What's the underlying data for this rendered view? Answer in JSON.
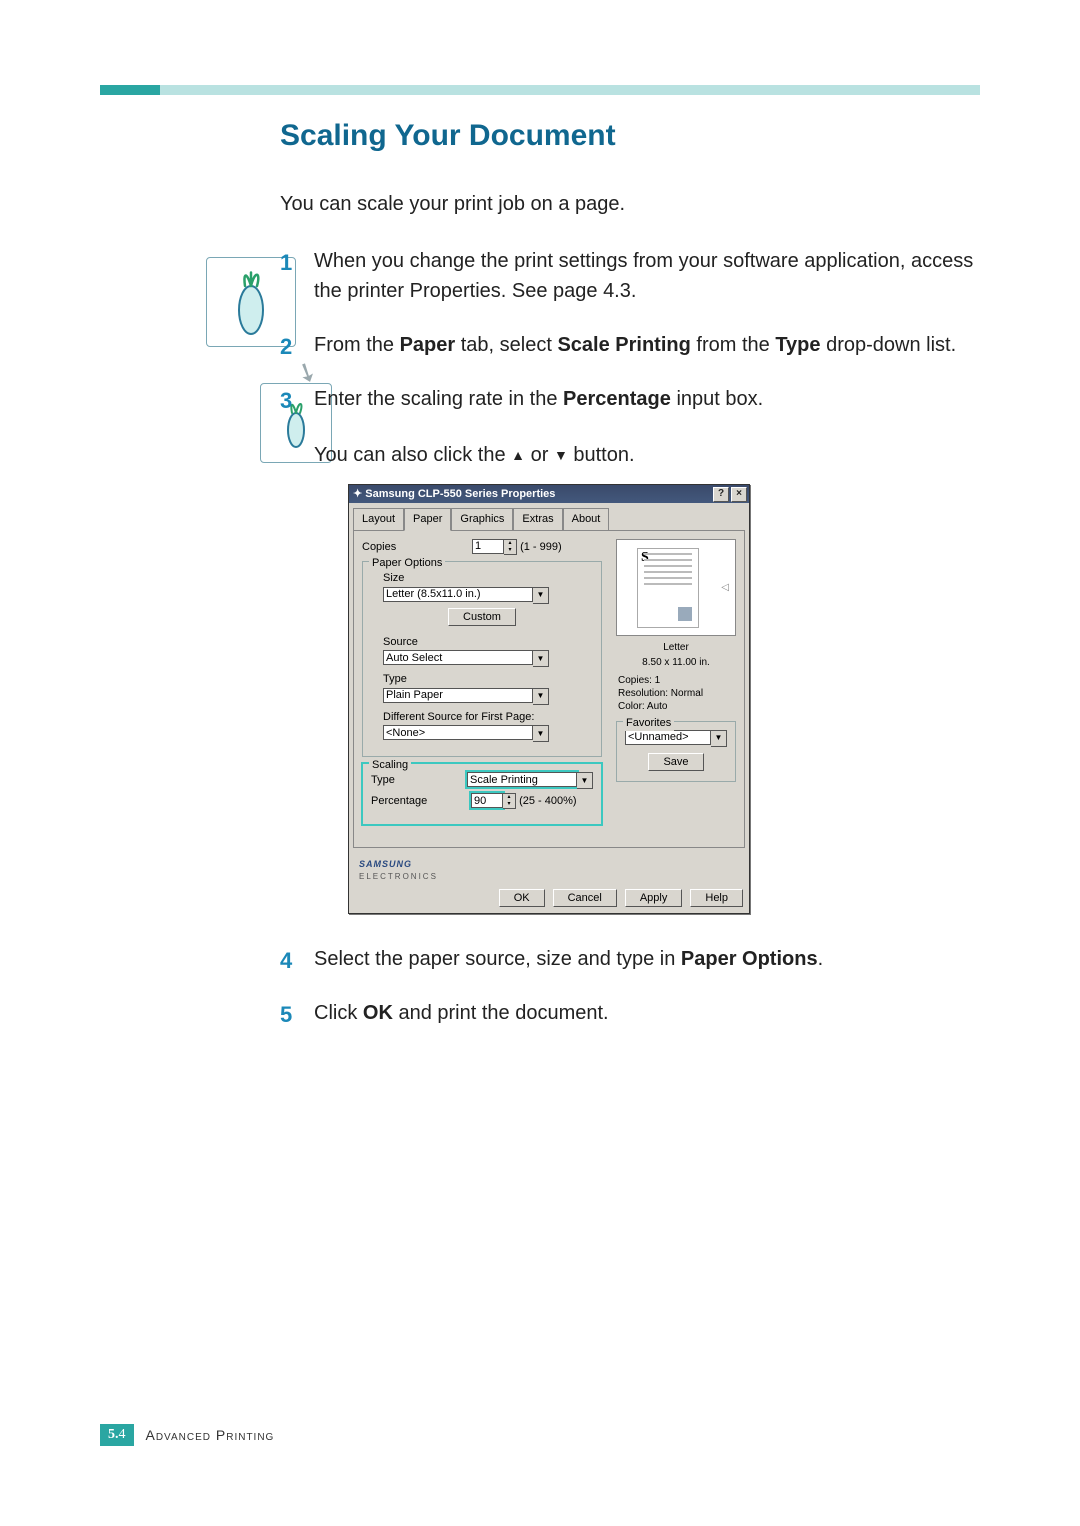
{
  "heading": "Scaling Your Document",
  "intro": "You can scale your print job on a page.",
  "steps": {
    "s1a": "When you change the print settings from your software application, access the printer Properties. See page 4.3.",
    "s2a": "From the ",
    "s2b": "Paper",
    "s2c": " tab, select ",
    "s2d": "Scale Printing",
    "s2e": " from the ",
    "s2f": "Type",
    "s2g": " drop-down list.",
    "s3a": "Enter the scaling rate in the ",
    "s3b": "Percentage",
    "s3c": " input box.",
    "s3d_pre": "You can also click the ",
    "s3d_mid": " or ",
    "s3d_post": " button.",
    "s4a": "Select the paper source, size and type in ",
    "s4b": "Paper Options",
    "s4c": ".",
    "s5a": "Click ",
    "s5b": "OK",
    "s5c": " and print the document."
  },
  "dialog": {
    "title": "Samsung CLP-550 Series Properties",
    "tabs": [
      "Layout",
      "Paper",
      "Graphics",
      "Extras",
      "About"
    ],
    "active_tab": "Paper",
    "copies_label": "Copies",
    "copies_value": "1",
    "copies_range": "(1 - 999)",
    "paper_options_label": "Paper Options",
    "size_label": "Size",
    "size_value": "Letter (8.5x11.0 in.)",
    "custom_btn": "Custom",
    "source_label": "Source",
    "source_value": "Auto Select",
    "type_label": "Type",
    "type_value": "Plain Paper",
    "diff_label": "Different Source for First Page:",
    "diff_value": "<None>",
    "scaling_label": "Scaling",
    "scaling_type_label": "Type",
    "scaling_type_value": "Scale Printing",
    "percentage_label": "Percentage",
    "percentage_value": "90",
    "percentage_range": "(25 - 400%)",
    "preview_size1": "Letter",
    "preview_size2": "8.50 x 11.00 in.",
    "info_copies": "Copies: 1",
    "info_res": "Resolution: Normal",
    "info_color": "Color: Auto",
    "favorites_label": "Favorites",
    "favorites_value": "<Unnamed>",
    "save_btn": "Save",
    "brand": "SAMSUNG",
    "brand_sub": "ELECTRONICS",
    "ok": "OK",
    "cancel": "Cancel",
    "apply": "Apply",
    "help": "Help"
  },
  "footer": {
    "chapter": "5.",
    "page": "4",
    "title": "Advanced Printing"
  }
}
